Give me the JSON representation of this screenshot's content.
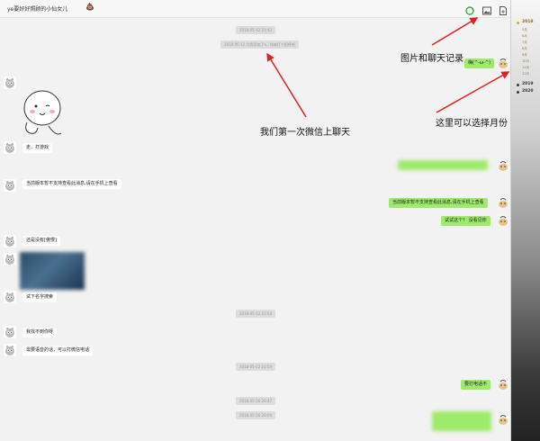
{
  "window": {
    "title": "ye要好好照顾的小仙女儿"
  },
  "toolbar": {
    "icons": [
      "refresh-icon",
      "image-icon",
      "export-icon"
    ]
  },
  "times": [
    "2018-05-12 21:43",
    "2018-05-12 21:54",
    "2018-05-12 21:54",
    "2018-05-16 20:47",
    "2018-05-16 20:04"
  ],
  "system_notice": "2018-05-12 为我添加了x，快来打个招呼吧",
  "messages": {
    "m1": "嗨(^-ω-^)",
    "m2": "走，打游戏",
    "m3": "当前版本暂不支持查看此消息,请在手机上查看",
    "m4": "当前版本暂不支持查看此消息,请在手机上查看",
    "m5": "试试这个？ 没看见你",
    "m6": "还是没有[傲慢]",
    "m7": "试下名字搜索",
    "m8": "我找不到你呀",
    "m9": "需要语音的话，可以打微信电话",
    "m10": "要打电话不"
  },
  "annotations": {
    "records": "图片和聊天记录",
    "first_chat": "我们第一次微信上聊天",
    "month_select": "这里可以选择月份"
  },
  "timeline": {
    "years": [
      "2018",
      "2019",
      "2020"
    ],
    "months": [
      "5月",
      "6月",
      "7月",
      "8月",
      "9月",
      "10月",
      "11月",
      "12月"
    ]
  },
  "colors": {
    "sent_bubble": "#9eea6a",
    "received_bubble": "#ffffff",
    "annotation_arrow": "#e02020",
    "timeline_accent": "#d8a52a"
  }
}
